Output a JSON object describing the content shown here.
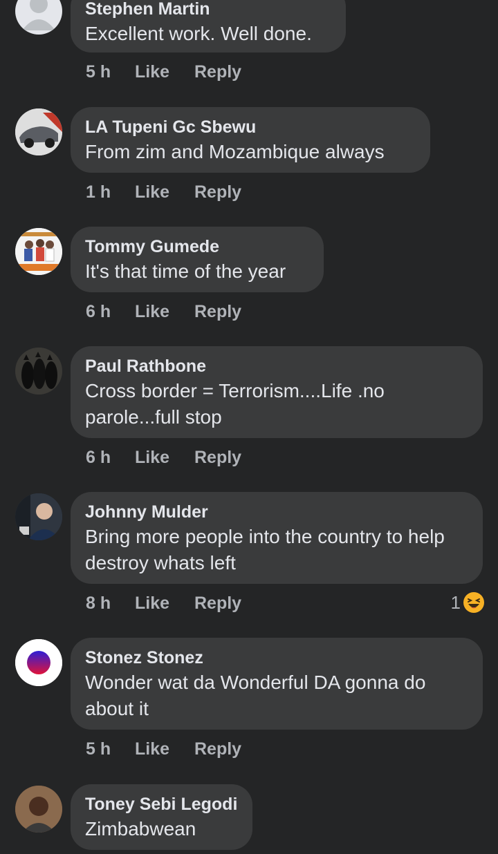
{
  "comments": [
    {
      "name": "Stephen Martin",
      "text": "Excellent work. Well done.",
      "time": "5 h",
      "like": "Like",
      "reply": "Reply",
      "avatar": "default-avatar"
    },
    {
      "name": "LA Tupeni Gc Sbewu",
      "text": "From zim and Mozambique always",
      "time": "1 h",
      "like": "Like",
      "reply": "Reply",
      "avatar": "car-photo"
    },
    {
      "name": "Tommy Gumede",
      "text": "It's that time of the year",
      "time": "6 h",
      "like": "Like",
      "reply": "Reply",
      "avatar": "poster-photo"
    },
    {
      "name": "Paul Rathbone",
      "text": "Cross border  = Terrorism....Life .no parole...full stop",
      "time": "6 h",
      "like": "Like",
      "reply": "Reply",
      "avatar": "dogs-photo"
    },
    {
      "name": "Johnny Mulder",
      "text": "Bring more people into the country to help destroy whats left",
      "time": "8 h",
      "like": "Like",
      "reply": "Reply",
      "avatar": "man-photo",
      "reaction_count": "1",
      "reaction_icon": "haha-icon"
    },
    {
      "name": "Stonez Stonez",
      "text": "Wonder wat da Wonderful DA gonna do about it",
      "time": "5 h",
      "like": "Like",
      "reply": "Reply",
      "avatar": "gradient-circle"
    },
    {
      "name": "Toney Sebi Legodi",
      "text": "Zimbabwean",
      "time": "",
      "like": "",
      "reply": "",
      "avatar": "man-photo"
    }
  ],
  "colors": {
    "background": "#242526",
    "bubble": "#3a3b3c",
    "name": "#e4e6eb",
    "meta": "#b0b3b8",
    "haha": "#f7b125"
  }
}
